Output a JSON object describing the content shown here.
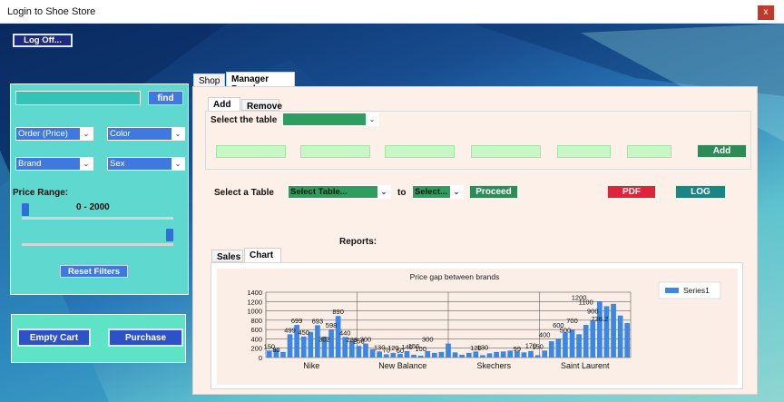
{
  "window": {
    "title": "Login to Shoe Store",
    "close_label": "x"
  },
  "header": {
    "logoff_label": "Log Off..."
  },
  "filter_panel": {
    "search_value": "",
    "find_label": "find",
    "order_select": "Order (Price)",
    "color_select": "Color",
    "brand_select": "Brand",
    "sex_select": "Sex",
    "price_range_label": "Price Range:",
    "price_range_value": "0 - 2000",
    "slider_min_fraction": 0.0,
    "slider_max_fraction": 1.0,
    "reset_label": "Reset Filters"
  },
  "cart": {
    "empty_label": "Empty Cart",
    "purchase_label": "Purchase"
  },
  "tabs": {
    "shop": "Shop",
    "manager": "Manager Panel"
  },
  "manager": {
    "subtabs": {
      "add": "Add",
      "remove": "Remove"
    },
    "select_table_label": "Select the table",
    "table_select_value": "",
    "add_button": "Add",
    "select_a_table_label": "Select a Table",
    "select_table_combo": "Select Table...",
    "to_label": "to",
    "select_combo": "Select...",
    "proceed_label": "Proceed",
    "pdf_label": "PDF",
    "log_label": "LOG",
    "reports_label": "Reports:",
    "report_tabs": {
      "sales": "Sales",
      "chart": "Chart"
    }
  },
  "colors": {
    "bar": "#3a87e6",
    "navy_button": "#1d2a82",
    "green": "#2e8b57",
    "pdf": "#e0223b",
    "log": "#1a8585"
  },
  "chart_data": {
    "type": "bar",
    "title": "Price gap between brands",
    "xlabel": "",
    "ylabel": "",
    "ylim": [
      0,
      1400
    ],
    "yticks": [
      0,
      200,
      400,
      600,
      800,
      1000,
      1200,
      1400
    ],
    "x_tick_labels": [
      "Nike",
      "New Balance",
      "Skechers",
      "Saint Laurent"
    ],
    "legend": {
      "position": "right",
      "entries": [
        "Series1"
      ]
    },
    "series": [
      {
        "name": "Series1",
        "values": [
          150,
          180,
          120,
          499,
          699,
          450,
          550,
          693,
          450,
          598,
          890,
          440,
          360,
          250,
          300,
          180,
          130,
          70,
          100,
          80,
          140,
          60,
          40,
          140,
          100,
          120,
          300,
          110,
          60,
          100,
          130,
          50,
          90,
          120,
          130,
          150,
          140,
          110,
          140,
          50,
          150,
          350,
          400,
          540,
          600,
          500,
          700,
          800,
          1200,
          1100,
          1150,
          900,
          738.2
        ],
        "labels": [
          150,
          80,
          null,
          499,
          699,
          450,
          null,
          693,
          302,
          598,
          890,
          440,
          288,
          258,
          300,
          null,
          130,
          70,
          120,
          60,
          140,
          156,
          100,
          300,
          null,
          null,
          null,
          null,
          null,
          null,
          120,
          130,
          null,
          null,
          null,
          null,
          99,
          null,
          170,
          150,
          400,
          null,
          600,
          500,
          700,
          1200,
          1100,
          900,
          738.2,
          null,
          null,
          null,
          null
        ]
      }
    ],
    "grid": true
  }
}
